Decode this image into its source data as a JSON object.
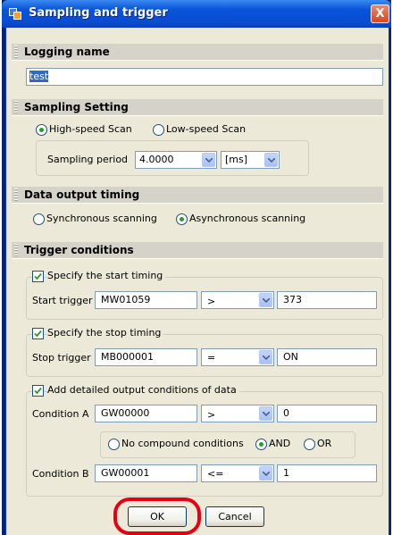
{
  "window": {
    "title": "Sampling and trigger",
    "close_label": "X"
  },
  "logging": {
    "header": "Logging name",
    "name_value": "test"
  },
  "sampling": {
    "header": "Sampling Setting",
    "high_speed_label": "High-speed Scan",
    "low_speed_label": "Low-speed Scan",
    "selected": "High-speed Scan",
    "period_label": "Sampling period",
    "period_value": "4.0000",
    "unit_value": "[ms]"
  },
  "output_timing": {
    "header": "Data output timing",
    "sync_label": "Synchronous scanning",
    "async_label": "Asynchronous scanning",
    "selected": "Asynchronous scanning"
  },
  "trigger": {
    "header": "Trigger conditions",
    "start": {
      "checkbox_label": "Specify the start timing",
      "checked": true,
      "row_label": "Start trigger",
      "register": "MW01059",
      "operator": ">",
      "value": "373"
    },
    "stop": {
      "checkbox_label": "Specify the stop timing",
      "checked": true,
      "row_label": "Stop trigger",
      "register": "MB000001",
      "operator": "=",
      "value": "ON"
    },
    "detail": {
      "checkbox_label": "Add detailed output conditions of data",
      "checked": true,
      "cond_a": {
        "label": "Condition A",
        "register": "GW00000",
        "operator": ">",
        "value": "0"
      },
      "compound": {
        "none_label": "No compound conditions",
        "and_label": "AND",
        "or_label": "OR",
        "selected": "AND"
      },
      "cond_b": {
        "label": "Condition B",
        "register": "GW00001",
        "operator": "<=",
        "value": "1"
      }
    }
  },
  "buttons": {
    "ok_label": "OK",
    "cancel_label": "Cancel"
  },
  "colors": {
    "title_bar": "#0a4bd0",
    "dialog_bg": "#ece9d8",
    "highlight_ring": "#e60012"
  }
}
